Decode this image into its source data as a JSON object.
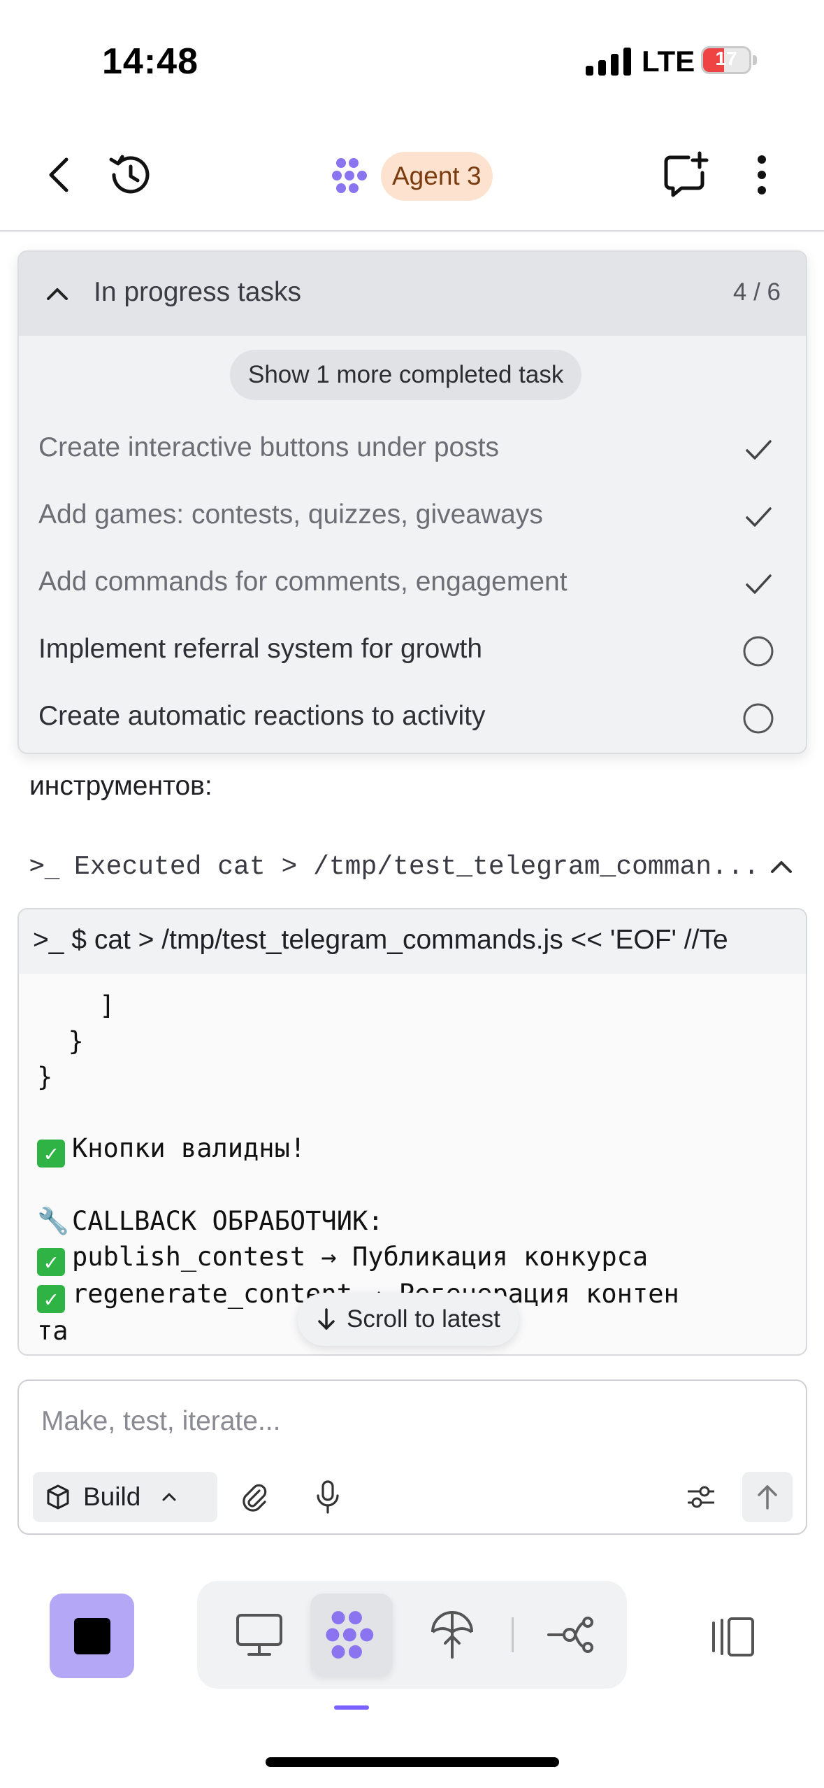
{
  "status_bar": {
    "time": "14:48",
    "network": "LTE",
    "battery_level": "17",
    "battery_color": "#ef4343"
  },
  "header": {
    "back_icon": "chevron-left-icon",
    "history_icon": "history-icon",
    "agent_label": "Agent 3",
    "new_chat_icon": "new-chat-icon",
    "more_icon": "more-vertical-icon"
  },
  "tasks": {
    "title": "In progress tasks",
    "count": "4 / 6",
    "show_more_label": "Show 1 more completed task",
    "items": [
      {
        "label": "Create interactive buttons under posts",
        "status": "done"
      },
      {
        "label": "Add games: contests, quizzes, giveaways",
        "status": "done"
      },
      {
        "label": "Add commands for comments, engagement",
        "status": "done"
      },
      {
        "label": "Implement referral system for growth",
        "status": "open"
      },
      {
        "label": "Create automatic reactions to activity",
        "status": "open"
      }
    ]
  },
  "chat": {
    "message_fragment": "инструментов:",
    "exec_prompt": ">_",
    "exec_label": "Executed cat > /tmp/test_telegram_comman...",
    "terminal": {
      "command": ">_ $ cat > /tmp/test_telegram_commands.js << 'EOF' //Te",
      "lines": {
        "l1": "    ]",
        "l2": "  }",
        "l3": "}",
        "l4": "Кнопки валидны!",
        "l5": "CALLBACK ОБРАБОТЧИК:",
        "l6": "publish_contest → Публикация конкурса",
        "l7": "regenerate_content → Регенерация контен",
        "l8": "та"
      }
    },
    "scroll_latest_label": "Scroll to latest"
  },
  "composer": {
    "placeholder": "Make, test, iterate...",
    "mode_label": "Build"
  },
  "colors": {
    "accent": "#7b61ff",
    "stop_button": "#b4a7f6",
    "agent_badge_bg": "#fde3cf",
    "check_green": "#2fb344"
  }
}
